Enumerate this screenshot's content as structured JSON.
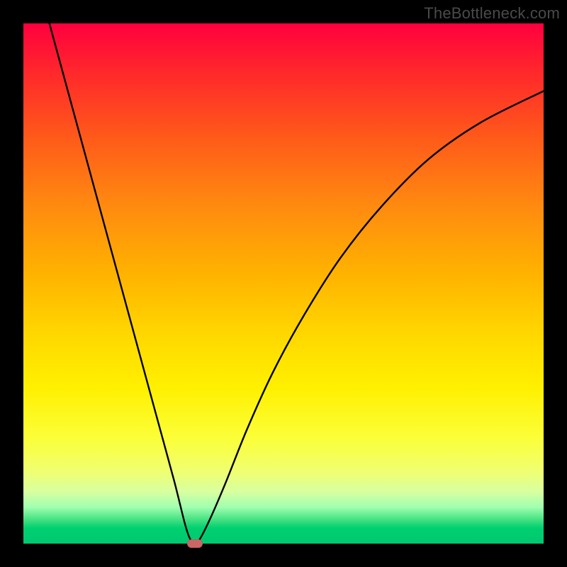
{
  "watermark": "TheBottleneck.com",
  "colors": {
    "frame": "#000000",
    "curve": "#000000",
    "marker": "#cc6666"
  },
  "chart_data": {
    "type": "line",
    "title": "",
    "xlabel": "",
    "ylabel": "",
    "xlim": [
      0,
      100
    ],
    "ylim": [
      0,
      100
    ],
    "grid": false,
    "series": [
      {
        "name": "bottleneck-curve",
        "x": [
          5,
          8,
          11,
          14,
          17,
          20,
          23,
          26,
          29,
          31,
          32,
          33,
          34,
          36,
          39,
          43,
          48,
          54,
          61,
          69,
          78,
          88,
          100
        ],
        "y": [
          100,
          89,
          78,
          67,
          56,
          45,
          34,
          23,
          12,
          4,
          1,
          0,
          1,
          5,
          12,
          22,
          33,
          44,
          55,
          65,
          74,
          81,
          87
        ]
      }
    ],
    "marker": {
      "x": 33,
      "y": 0
    },
    "gradient_stops": [
      {
        "pct": 0,
        "hex": "#ff003f"
      },
      {
        "pct": 10,
        "hex": "#ff2a2a"
      },
      {
        "pct": 22,
        "hex": "#ff5a1a"
      },
      {
        "pct": 35,
        "hex": "#ff8a10"
      },
      {
        "pct": 48,
        "hex": "#ffb200"
      },
      {
        "pct": 60,
        "hex": "#ffd800"
      },
      {
        "pct": 70,
        "hex": "#fff000"
      },
      {
        "pct": 80,
        "hex": "#fbff3a"
      },
      {
        "pct": 86,
        "hex": "#f0ff70"
      },
      {
        "pct": 90,
        "hex": "#d8ffa0"
      },
      {
        "pct": 93,
        "hex": "#a0ffb0"
      },
      {
        "pct": 95.5,
        "hex": "#40e080"
      },
      {
        "pct": 97,
        "hex": "#00d070"
      },
      {
        "pct": 100,
        "hex": "#00c870"
      }
    ]
  }
}
